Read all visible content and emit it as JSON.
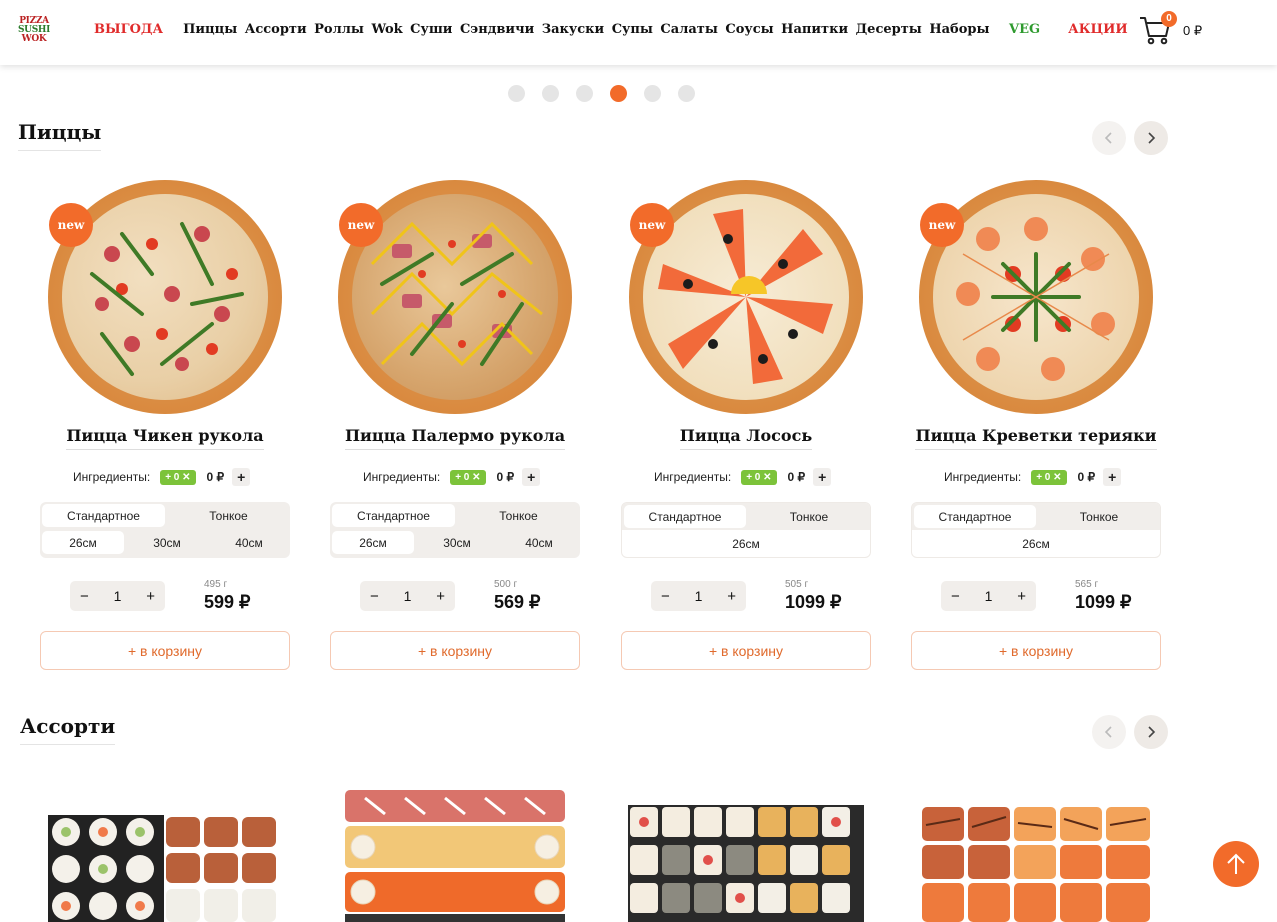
{
  "logo": {
    "line1": "PIZZA",
    "line2": "SUSHI",
    "line3": "WOK"
  },
  "nav": {
    "promo": "ВЫГОДА",
    "items": [
      "Пиццы",
      "Ассорти",
      "Роллы",
      "Wok",
      "Суши",
      "Сэндвичи",
      "Закуски",
      "Супы",
      "Салаты",
      "Соусы",
      "Напитки",
      "Десерты",
      "Наборы"
    ],
    "veg": "VEG",
    "sale": "АКЦИИ"
  },
  "cart": {
    "count": "0",
    "total": "0 ₽"
  },
  "slider": {
    "dots": 6,
    "active_index": 3
  },
  "sections": {
    "pizzas": "Пиццы",
    "assorti": "Ассорти"
  },
  "badge_new": "new",
  "ingredients_label": "Ингредиенты:",
  "ingredients_chip": "+ 0",
  "ingredients_price": "0 ₽",
  "dough": {
    "standard": "Стандартное",
    "thin": "Тонкое"
  },
  "add_to_cart": "+ в корзину",
  "pizzas": [
    {
      "name": "Пицца Чикен рукола",
      "sizes": [
        "26см",
        "30см",
        "40см"
      ],
      "qty": "1",
      "weight": "495 г",
      "price": "599 ₽"
    },
    {
      "name": "Пицца Палермо рукола",
      "sizes": [
        "26см",
        "30см",
        "40см"
      ],
      "qty": "1",
      "weight": "500 г",
      "price": "569 ₽"
    },
    {
      "name": "Пицца Лосось",
      "sizes": [
        "26см"
      ],
      "qty": "1",
      "weight": "505 г",
      "price": "1099 ₽"
    },
    {
      "name": "Пицца Креветки терияки",
      "sizes": [
        "26см"
      ],
      "qty": "1",
      "weight": "565 г",
      "price": "1099 ₽"
    }
  ],
  "colors": {
    "accent": "#f26b2a",
    "promo": "#e02b2b",
    "veg": "#2e9a2e",
    "chip": "#7cc33a"
  }
}
